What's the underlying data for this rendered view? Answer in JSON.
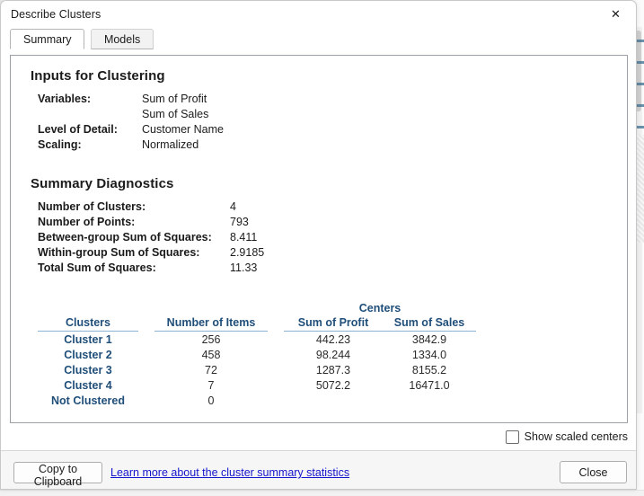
{
  "window": {
    "title": "Describe Clusters",
    "close_glyph": "✕"
  },
  "tabs": [
    {
      "label": "Summary",
      "selected": true
    },
    {
      "label": "Models",
      "selected": false
    }
  ],
  "inputs_section": {
    "heading": "Inputs for Clustering",
    "rows": [
      {
        "key": "Variables:",
        "value": "Sum of Profit"
      },
      {
        "key": "",
        "value": "Sum of Sales"
      },
      {
        "key": "Level of Detail:",
        "value": "Customer Name"
      },
      {
        "key": "Scaling:",
        "value": "Normalized"
      }
    ]
  },
  "diagnostics_section": {
    "heading": "Summary Diagnostics",
    "rows": [
      {
        "key": "Number of Clusters:",
        "value": "4"
      },
      {
        "key": "Number of Points:",
        "value": "793"
      },
      {
        "key": "Between-group Sum of Squares:",
        "value": "8.411"
      },
      {
        "key": "Within-group Sum of Squares:",
        "value": "2.9185"
      },
      {
        "key": "Total Sum of Squares:",
        "value": "11.33"
      }
    ]
  },
  "cluster_table": {
    "group_header": "Centers",
    "headers": {
      "clusters": "Clusters",
      "items": "Number of Items",
      "profit": "Sum of Profit",
      "sales": "Sum of Sales"
    },
    "rows": [
      {
        "cluster": "Cluster 1",
        "items": "256",
        "profit": "442.23",
        "sales": "3842.9"
      },
      {
        "cluster": "Cluster 2",
        "items": "458",
        "profit": "98.244",
        "sales": "1334.0"
      },
      {
        "cluster": "Cluster 3",
        "items": "72",
        "profit": "1287.3",
        "sales": "8155.2"
      },
      {
        "cluster": "Cluster 4",
        "items": "7",
        "profit": "5072.2",
        "sales": "16471.0"
      },
      {
        "cluster": "Not Clustered",
        "items": "0",
        "profit": "",
        "sales": ""
      }
    ]
  },
  "options": {
    "show_scaled_centers_label": "Show scaled centers",
    "show_scaled_centers_checked": false
  },
  "footer": {
    "copy_label": "Copy to Clipboard",
    "help_link": "Learn more about the cluster summary statistics",
    "close_label": "Close"
  },
  "colors": {
    "table_header": "#1F4E79",
    "link": "#1414CC",
    "text": "#1B1B1B",
    "panel_border": "#9AA0A6"
  }
}
